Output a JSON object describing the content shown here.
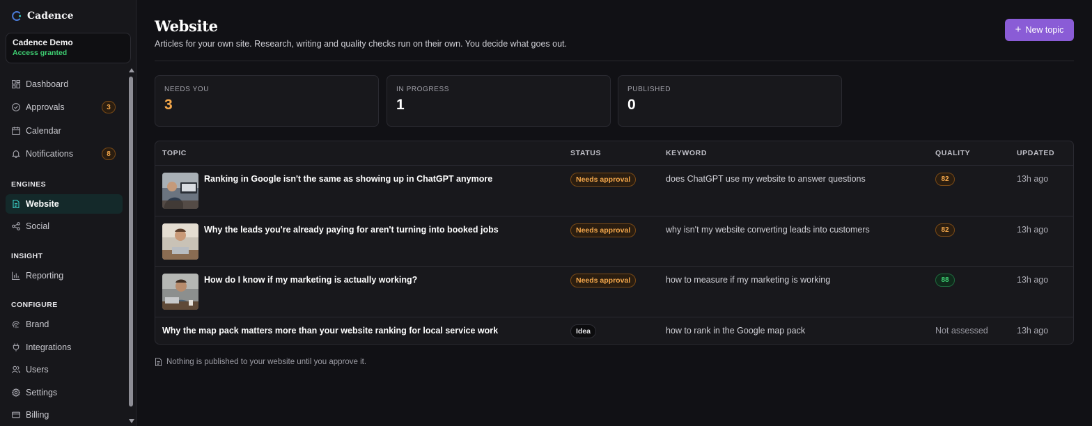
{
  "app": {
    "brand": "Cadence",
    "account": {
      "name": "Cadence Demo",
      "status": "Access granted"
    }
  },
  "sidebar": {
    "items": [
      {
        "label": "Dashboard",
        "icon": "dashboard-icon"
      },
      {
        "label": "Approvals",
        "icon": "check-circle-icon",
        "badge": "3"
      },
      {
        "label": "Calendar",
        "icon": "calendar-icon"
      },
      {
        "label": "Notifications",
        "icon": "bell-icon",
        "badge": "8"
      }
    ],
    "sections": [
      {
        "label": "ENGINES",
        "items": [
          {
            "label": "Website",
            "icon": "document-icon",
            "active": true
          },
          {
            "label": "Social",
            "icon": "share-icon"
          }
        ]
      },
      {
        "label": "INSIGHT",
        "items": [
          {
            "label": "Reporting",
            "icon": "bar-chart-icon"
          }
        ]
      },
      {
        "label": "CONFIGURE",
        "items": [
          {
            "label": "Brand",
            "icon": "fingerprint-icon"
          },
          {
            "label": "Integrations",
            "icon": "plug-icon"
          },
          {
            "label": "Users",
            "icon": "users-icon"
          },
          {
            "label": "Settings",
            "icon": "gear-icon"
          },
          {
            "label": "Billing",
            "icon": "credit-card-icon"
          }
        ]
      }
    ]
  },
  "header": {
    "title": "Website",
    "subtitle": "Articles for your own site. Research, writing and quality checks run on their own. You decide what goes out.",
    "new_topic_label": "New topic"
  },
  "stats": [
    {
      "label": "NEEDS YOU",
      "value": "3"
    },
    {
      "label": "IN PROGRESS",
      "value": "1"
    },
    {
      "label": "PUBLISHED",
      "value": "0"
    }
  ],
  "table": {
    "columns": [
      "TOPIC",
      "STATUS",
      "KEYWORD",
      "QUALITY",
      "UPDATED"
    ],
    "rows": [
      {
        "topic": "Ranking in Google isn't the same as showing up in ChatGPT anymore",
        "status": "Needs approval",
        "keyword": "does ChatGPT use my website to answer questions",
        "quality": "82",
        "updated": "13h ago"
      },
      {
        "topic": "Why the leads you're already paying for aren't turning into booked jobs",
        "status": "Needs approval",
        "keyword": "why isn't my website converting leads into customers",
        "quality": "82",
        "updated": "13h ago"
      },
      {
        "topic": "How do I know if my marketing is actually working?",
        "status": "Needs approval",
        "keyword": "how to measure if my marketing is working",
        "quality": "88",
        "updated": "13h ago"
      },
      {
        "topic": "Why the map pack matters more than your website ranking for local service work",
        "status": "Idea",
        "keyword": "how to rank in the Google map pack",
        "quality": "Not assessed",
        "updated": "13h ago"
      }
    ]
  },
  "footnote": "Nothing is published to your website until you approve it.",
  "colors": {
    "accent_purple": "#8a5cd6",
    "accent_teal": "#38c6c0",
    "amber": "#f5a84b",
    "green": "#3ecf72",
    "background": "#111115"
  }
}
